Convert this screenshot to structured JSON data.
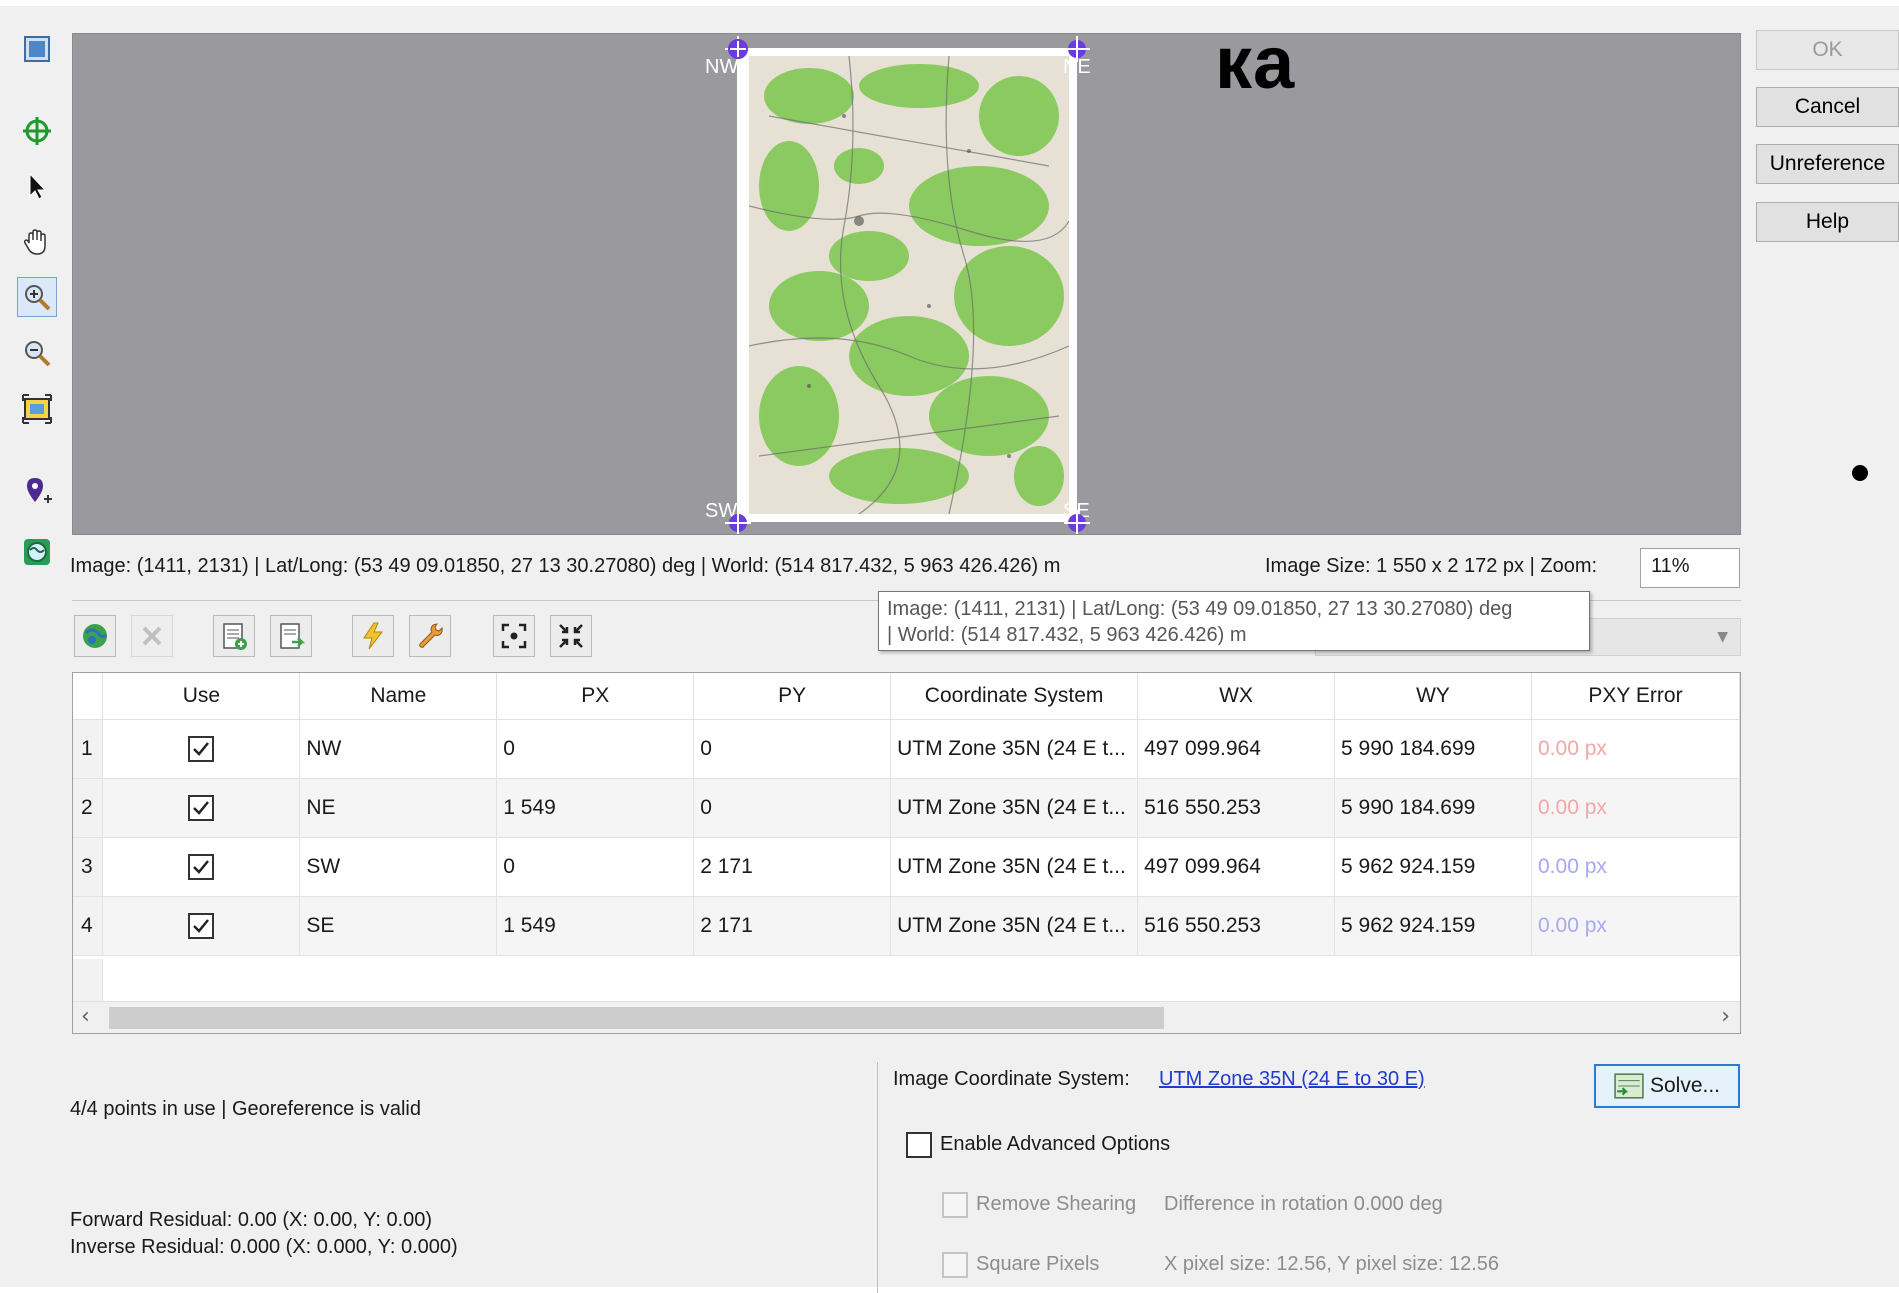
{
  "overlay_text": "ка",
  "right_buttons": {
    "ok": "OK",
    "cancel": "Cancel",
    "unreference": "Unreference",
    "help": "Help"
  },
  "map": {
    "corner_labels": {
      "nw": "NW",
      "ne": "NE",
      "sw": "SW",
      "se": "SE"
    }
  },
  "status": {
    "coords": "Image: (1411, 2131) | Lat/Long: (53 49 09.01850, 27 13 30.27080) deg | World: (514 817.432, 5 963 426.426) m",
    "image_size": "Image Size: 1 550 x 2 172 px |  Zoom:",
    "zoom": "11%"
  },
  "tooltip": {
    "line1": "Image: (1411, 2131) | Lat/Long: (53 49 09.01850, 27 13 30.27080) deg",
    "line2": "| World: (514 817.432, 5 963 426.426) m"
  },
  "table": {
    "headers": [
      "Use",
      "Name",
      "PX",
      "PY",
      "Coordinate System",
      "WX",
      "WY",
      "PXY Error"
    ],
    "rows": [
      {
        "n": "1",
        "name": "NW",
        "px": "0",
        "py": "0",
        "cs": "UTM Zone 35N (24 E t...",
        "wx": "497 099.964",
        "wy": "5 990 184.699",
        "err": "0.00 px",
        "err_color": "#f2a7a7"
      },
      {
        "n": "2",
        "name": "NE",
        "px": "1 549",
        "py": "0",
        "cs": "UTM Zone 35N (24 E t...",
        "wx": "516 550.253",
        "wy": "5 990 184.699",
        "err": "0.00 px",
        "err_color": "#f2a7a7"
      },
      {
        "n": "3",
        "name": "SW",
        "px": "0",
        "py": "2 171",
        "cs": "UTM Zone 35N (24 E t...",
        "wx": "497 099.964",
        "wy": "5 962 924.159",
        "err": "0.00 px",
        "err_color": "#a8a8f5"
      },
      {
        "n": "4",
        "name": "SE",
        "px": "1 549",
        "py": "2 171",
        "cs": "UTM Zone 35N (24 E t...",
        "wx": "516 550.253",
        "wy": "5 962 924.159",
        "err": "0.00 px",
        "err_color": "#a8a8f5"
      }
    ]
  },
  "bottom": {
    "points_status": "4/4 points in use | Georeference is valid",
    "forward_residual": "Forward Residual: 0.00 (X: 0.00, Y: 0.00)",
    "inverse_residual": "Inverse Residual: 0.000 (X: 0.000, Y: 0.000)",
    "ics_label": "Image Coordinate System:",
    "ics_value": "UTM Zone 35N (24 E to 30 E)",
    "solve": "Solve...",
    "enable_advanced": "Enable Advanced Options",
    "remove_shearing": "Remove Shearing",
    "rotation_diff": "Difference in rotation 0.000 deg",
    "square_pixels": "Square Pixels",
    "pixel_size": "X pixel size: 12.56, Y pixel size: 12.56"
  }
}
